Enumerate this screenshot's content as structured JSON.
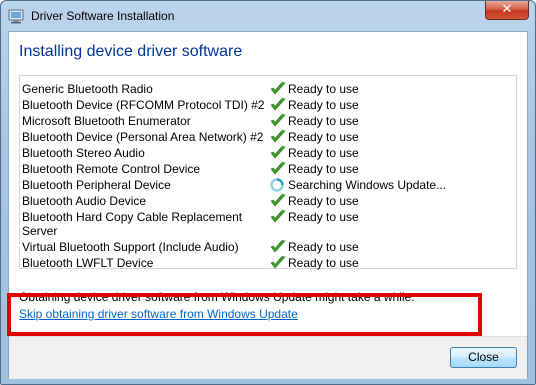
{
  "window": {
    "title": "Driver Software Installation",
    "close_glyph": "✕"
  },
  "main": {
    "heading": "Installing device driver software",
    "devices": [
      {
        "name": "Generic Bluetooth Radio",
        "status": "Ready to use",
        "status_icon": "check-icon"
      },
      {
        "name": "Bluetooth Device (RFCOMM Protocol TDI) #2",
        "status": "Ready to use",
        "status_icon": "check-icon"
      },
      {
        "name": "Microsoft Bluetooth Enumerator",
        "status": "Ready to use",
        "status_icon": "check-icon"
      },
      {
        "name": "Bluetooth Device (Personal Area Network) #2",
        "status": "Ready to use",
        "status_icon": "check-icon"
      },
      {
        "name": "Bluetooth Stereo Audio",
        "status": "Ready to use",
        "status_icon": "check-icon"
      },
      {
        "name": "Bluetooth Remote Control Device",
        "status": "Ready to use",
        "status_icon": "check-icon"
      },
      {
        "name": "Bluetooth Peripheral Device",
        "status": "Searching Windows Update...",
        "status_icon": "spinner-icon"
      },
      {
        "name": "Bluetooth Audio Device",
        "status": "Ready to use",
        "status_icon": "check-icon"
      },
      {
        "name": "Bluetooth Hard Copy Cable Replacement Server",
        "status": "Ready to use",
        "status_icon": "check-icon"
      },
      {
        "name": "Virtual Bluetooth Support (Include Audio)",
        "status": "Ready to use",
        "status_icon": "check-icon"
      },
      {
        "name": "Bluetooth LWFLT Device",
        "status": "Ready to use",
        "status_icon": "check-icon"
      }
    ],
    "info_text": "Obtaining device driver software from Windows Update might take a while.",
    "skip_link": "Skip obtaining driver software from Windows Update"
  },
  "footer": {
    "close_label": "Close"
  },
  "colors": {
    "heading": "#003399",
    "link": "#0066cc",
    "check": "#3fa02d",
    "highlight_box": "#e00000"
  }
}
